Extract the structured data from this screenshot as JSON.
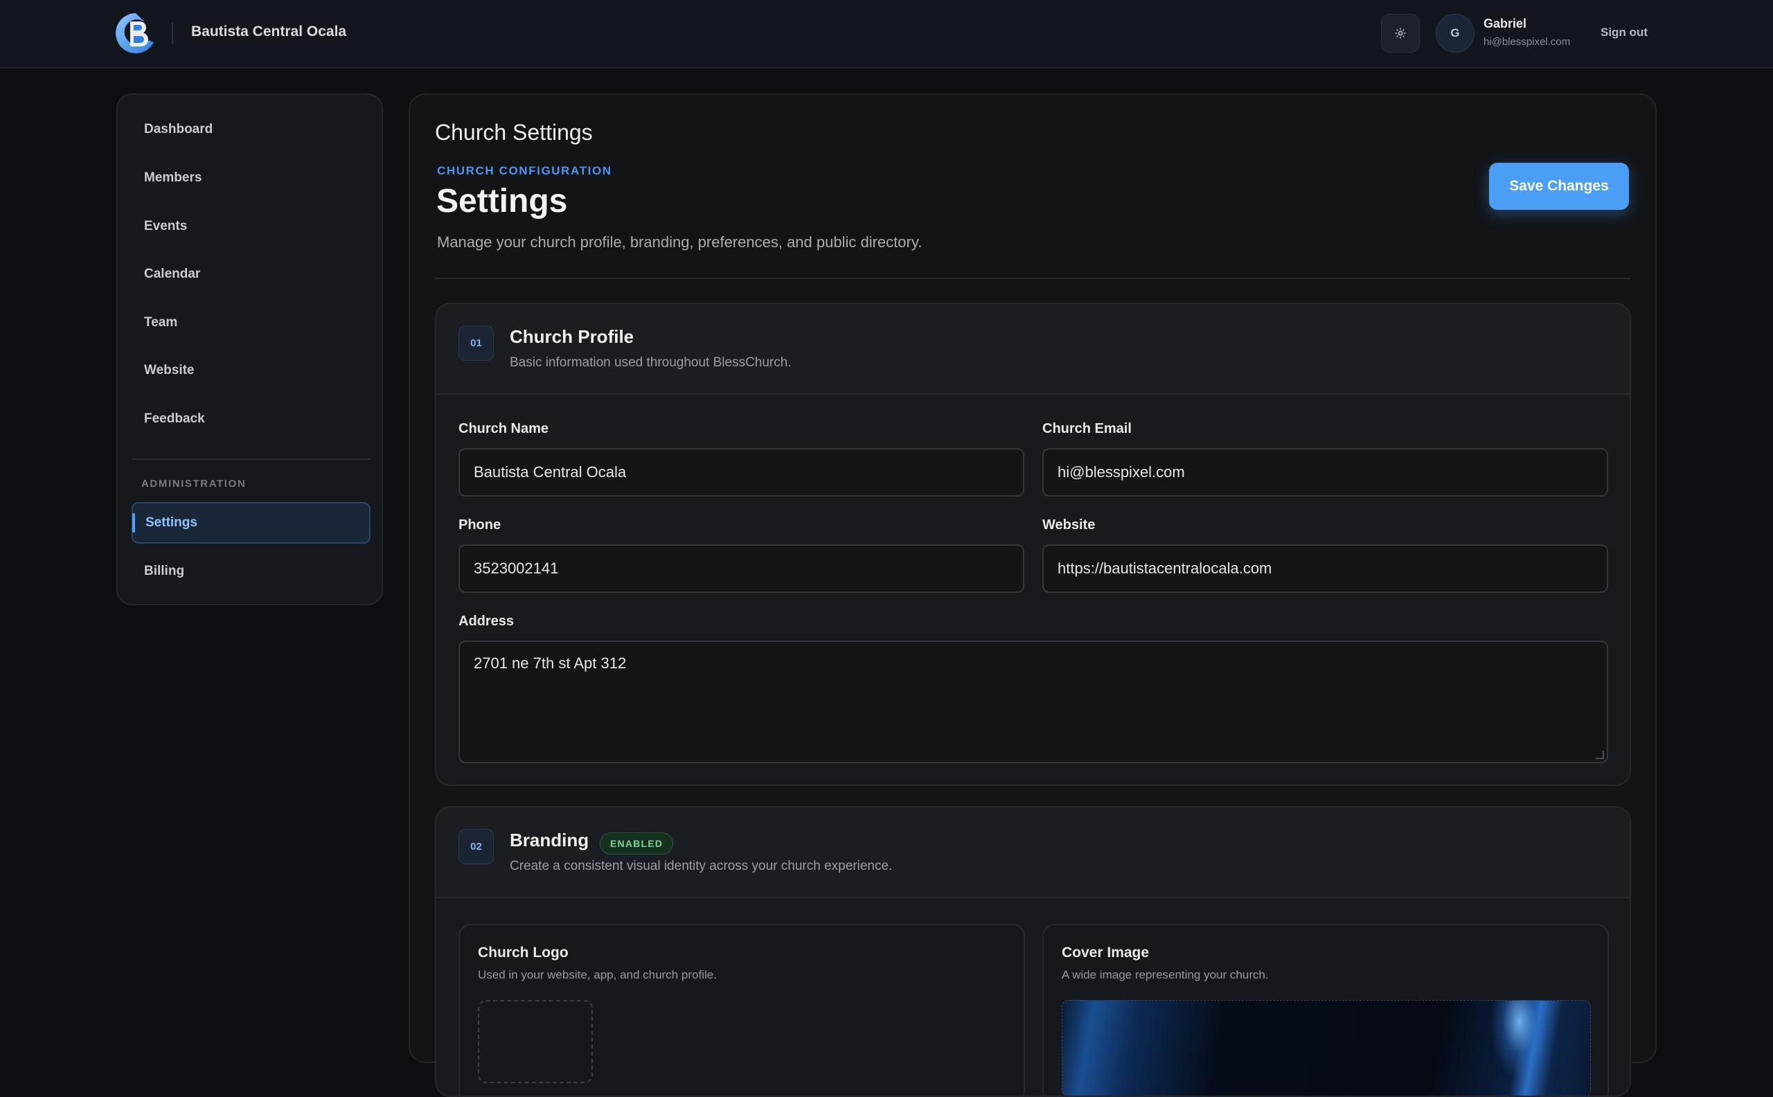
{
  "header": {
    "church_name": "Bautista Central Ocala",
    "user_initial": "G",
    "user_name": "Gabriel",
    "user_email": "hi@blesspixel.com",
    "sign_out_label": "Sign out",
    "settings_icon": "gear-icon",
    "logo_letter": "B",
    "brand_color": "#4a9ff5"
  },
  "sidebar": {
    "items": [
      {
        "label": "Dashboard"
      },
      {
        "label": "Members"
      },
      {
        "label": "Events"
      },
      {
        "label": "Calendar"
      },
      {
        "label": "Team"
      },
      {
        "label": "Website"
      },
      {
        "label": "Feedback"
      }
    ],
    "section_label": "ADMINISTRATION",
    "admin_items": [
      {
        "label": "Settings",
        "active": true
      },
      {
        "label": "Billing",
        "active": false
      }
    ]
  },
  "page": {
    "header_title": "Church Settings",
    "eyebrow": "CHURCH CONFIGURATION",
    "title": "Settings",
    "subtitle": "Manage your church profile, branding, preferences, and public directory.",
    "save_label": "Save Changes"
  },
  "profile": {
    "step": "01",
    "title": "Church Profile",
    "description": "Basic information used throughout BlessChurch.",
    "fields": {
      "name_label": "Church Name",
      "name_value": "Bautista Central Ocala",
      "email_label": "Church Email",
      "email_value": "hi@blesspixel.com",
      "phone_label": "Phone",
      "phone_value": "3523002141",
      "website_label": "Website",
      "website_value": "https://bautistacentralocala.com",
      "address_label": "Address",
      "address_value": "2701 ne 7th st Apt 312"
    }
  },
  "branding": {
    "step": "02",
    "title": "Branding",
    "status": "ENABLED",
    "description": "Create a consistent visual identity across your church experience.",
    "logo": {
      "title": "Church Logo",
      "description": "Used in your website, app, and church profile."
    },
    "cover": {
      "title": "Cover Image",
      "description": "A wide image representing your church."
    }
  }
}
